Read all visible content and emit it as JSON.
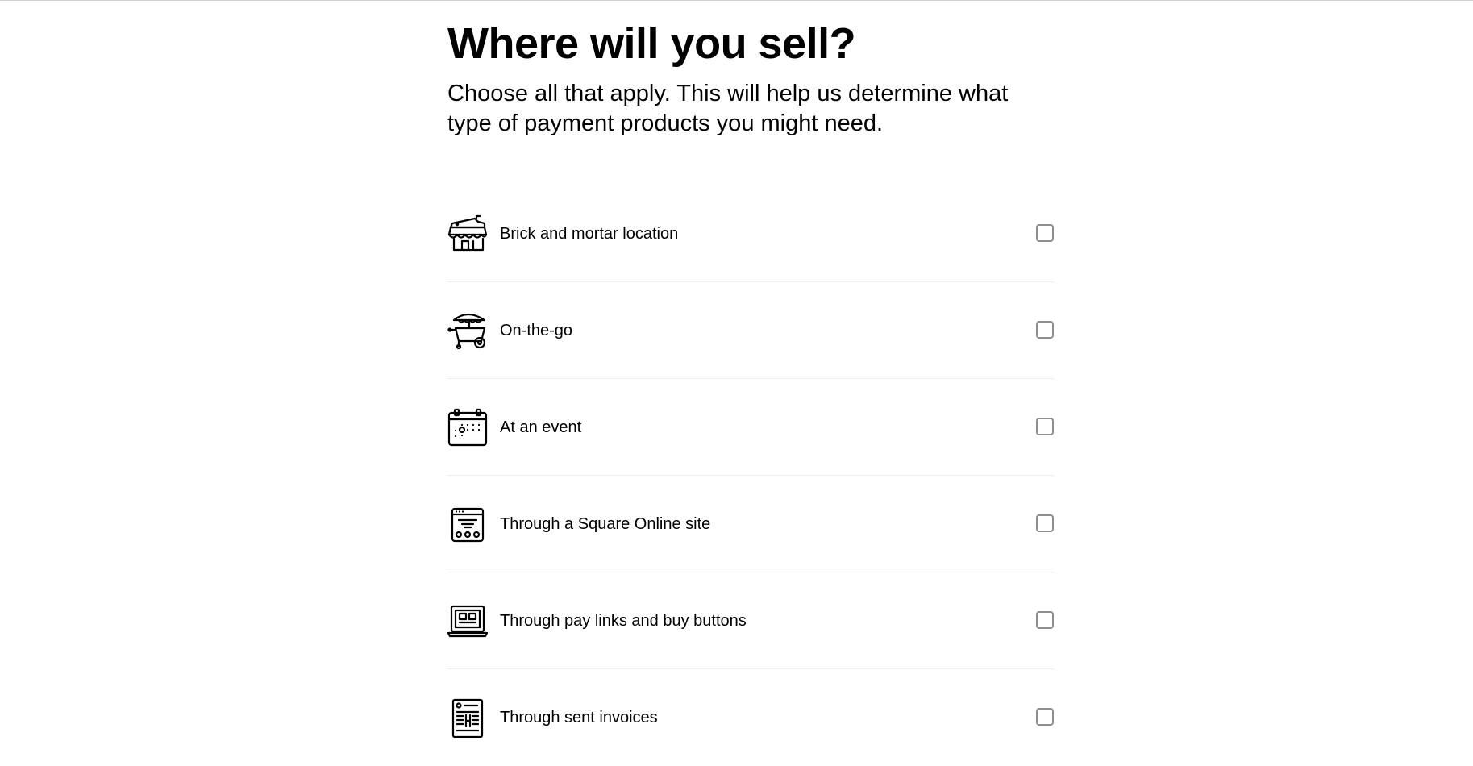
{
  "page": {
    "title": "Where will you sell?",
    "subtitle": "Choose all that apply. This will help us determine what type of payment products you might need."
  },
  "options": [
    {
      "label": "Brick and mortar location",
      "icon": "storefront-icon",
      "checked": false
    },
    {
      "label": "On-the-go",
      "icon": "food-cart-icon",
      "checked": false
    },
    {
      "label": "At an event",
      "icon": "calendar-event-icon",
      "checked": false
    },
    {
      "label": "Through a Square Online site",
      "icon": "website-icon",
      "checked": false
    },
    {
      "label": "Through pay links and buy buttons",
      "icon": "laptop-icon",
      "checked": false
    },
    {
      "label": "Through sent invoices",
      "icon": "invoice-icon",
      "checked": false
    }
  ],
  "colors": {
    "text": "#000000",
    "divider": "#ececec",
    "checkbox_border": "#8e8e8e"
  }
}
